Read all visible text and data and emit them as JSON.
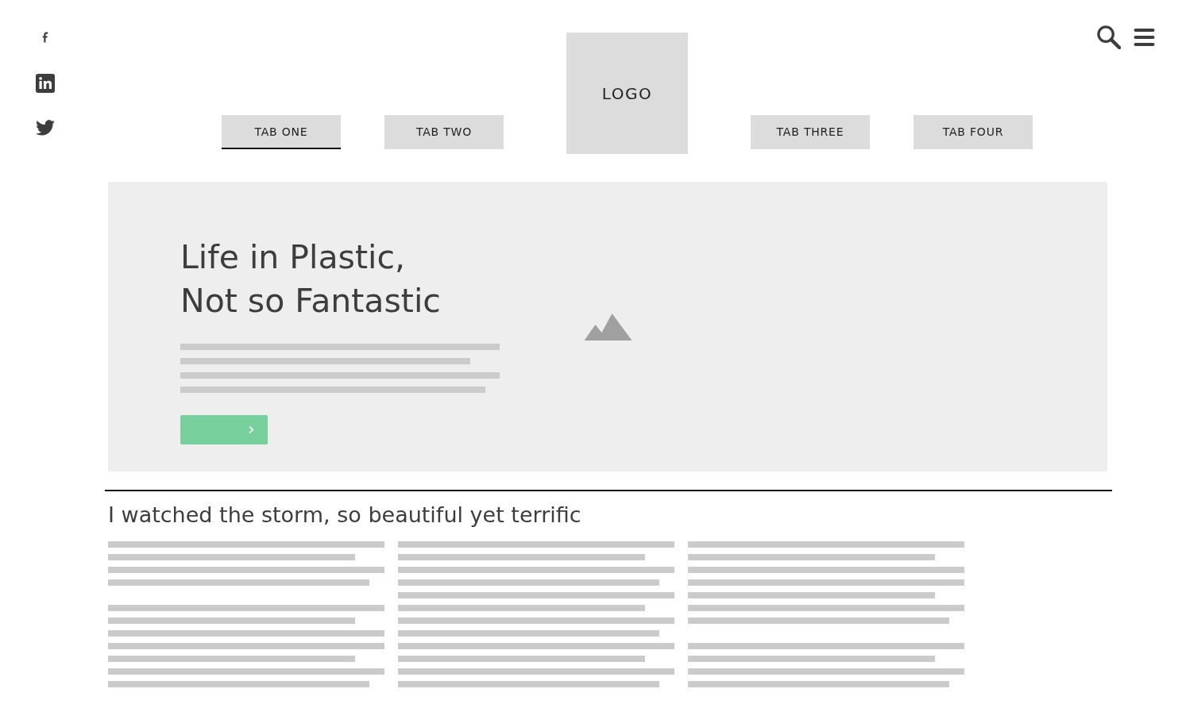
{
  "social": [
    {
      "kind": "facebook"
    },
    {
      "kind": "linkedin"
    },
    {
      "kind": "twitter"
    }
  ],
  "nav": [
    {
      "kind": "tab",
      "label": "TAB ONE",
      "selected": true
    },
    {
      "kind": "tab",
      "label": "TAB TWO",
      "selected": false
    },
    {
      "kind": "logo",
      "label": "LOGO"
    },
    {
      "kind": "tab",
      "label": "TAB THREE",
      "selected": false
    },
    {
      "kind": "tab",
      "label": "TAB FOUR",
      "selected": false
    }
  ],
  "hero": {
    "title_lines": [
      "Life in Plastic,",
      "Not so Fantastic"
    ]
  },
  "section": {
    "heading": "I watched the storm, so beautiful yet terrific"
  }
}
